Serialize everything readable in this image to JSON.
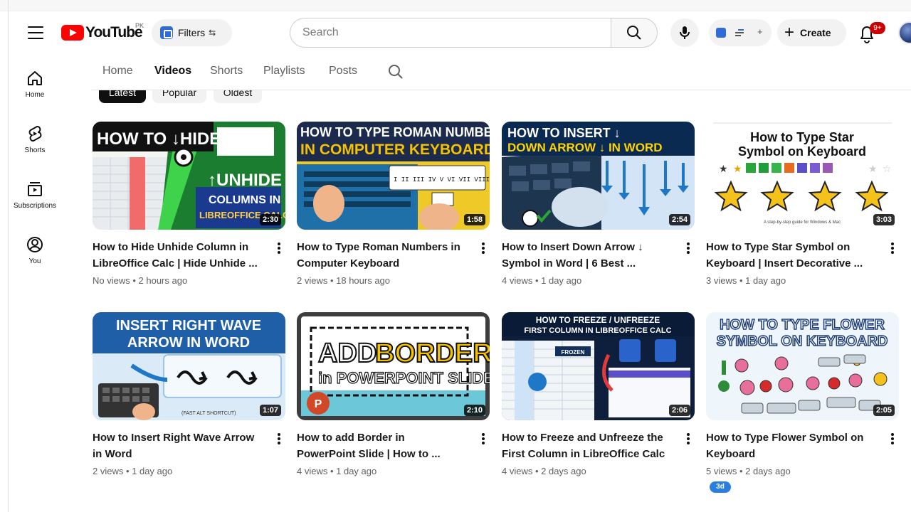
{
  "header": {
    "logo_text": "YouTube",
    "country_code": "PK",
    "filters_label": "Filters",
    "filters_trail": "⇆",
    "search_placeholder": "Search",
    "create_label": "Create",
    "notif_badge": "9+",
    "ext_trail": "+"
  },
  "sidebar": {
    "items": [
      {
        "label": "Home",
        "icon": "home-icon"
      },
      {
        "label": "Shorts",
        "icon": "shorts-icon"
      },
      {
        "label": "Subscriptions",
        "icon": "subscriptions-icon"
      },
      {
        "label": "You",
        "icon": "you-icon"
      }
    ]
  },
  "tabs": [
    "Home",
    "Videos",
    "Shorts",
    "Playlists",
    "Posts"
  ],
  "active_tab": "Videos",
  "chips": [
    "Latest",
    "Popular",
    "Oldest"
  ],
  "videos": [
    {
      "title_1": "How to Hide Unhide Column in",
      "title_2": "LibreOffice Calc | Hide Unhide ...",
      "meta": "No views • 2 hours ago",
      "duration": "2:30",
      "thumb_lines": [
        "HOW TO ↓HIDE",
        "↑UNHIDE",
        "COLUMNS IN",
        "LIBREOFFICE CALC"
      ]
    },
    {
      "title_1": "How to Type Roman Numbers in",
      "title_2": "Computer Keyboard",
      "meta": "2 views • 18 hours ago",
      "duration": "1:58",
      "thumb_lines": [
        "HOW TO TYPE ROMAN NUMBERS",
        "IN COMPUTER KEYBOARD",
        "I II III IV V VI VII VIII IX XII"
      ]
    },
    {
      "title_1": "How to Insert Down Arrow ↓",
      "title_2": "Symbol in Word | 6 Best ...",
      "meta": "4 views • 1 day ago",
      "duration": "2:54",
      "thumb_lines": [
        "HOW TO INSERT ↓",
        "DOWN ARROW ↓ IN WORD"
      ]
    },
    {
      "title_1": "How to Type Star Symbol on",
      "title_2": "Keyboard | Insert Decorative ...",
      "meta": "3 views • 1 day ago",
      "duration": "3:03",
      "thumb_lines": [
        "How to Type Star",
        "Symbol on Keyboard",
        "A step-by-step guide for Windows & Mac"
      ]
    },
    {
      "title_1": "How to Insert Right Wave Arrow",
      "title_2": "in Word",
      "meta": "2 views • 1 day ago",
      "duration": "1:07",
      "thumb_lines": [
        "INSERT RIGHT WAVE",
        "ARROW IN WORD",
        "(FAST ALT SHORTCUT)"
      ]
    },
    {
      "title_1": "How to add Border in",
      "title_2": "PowerPoint Slide | How to ...",
      "meta": "4 views • 1 day ago",
      "duration": "2:10",
      "thumb_lines": [
        "ADD",
        "BORDER",
        "in POWERPOINT SLIDE"
      ]
    },
    {
      "title_1": "How to Freeze and Unfreeze the",
      "title_2": "First Column in LibreOffice Calc",
      "meta": "4 views • 2 days ago",
      "duration": "2:06",
      "thumb_lines": [
        "HOW TO FREEZE / UNFREEZE",
        "FIRST COLUMN IN LIBREOFFICE CALC",
        "FROZEN"
      ]
    },
    {
      "title_1": "How to Type Flower Symbol on",
      "title_2": "Keyboard",
      "meta": "5 views • 2 days ago",
      "duration": "2:05",
      "thumb_lines": [
        "HOW TO TYPE FLOWER",
        "SYMBOL ON KEYBOARD"
      ]
    }
  ],
  "new_badge": "3d",
  "colors": {
    "brand_red": "#ff0000",
    "accent_blue": "#2f6cd6",
    "badge_red": "#cc0000"
  }
}
